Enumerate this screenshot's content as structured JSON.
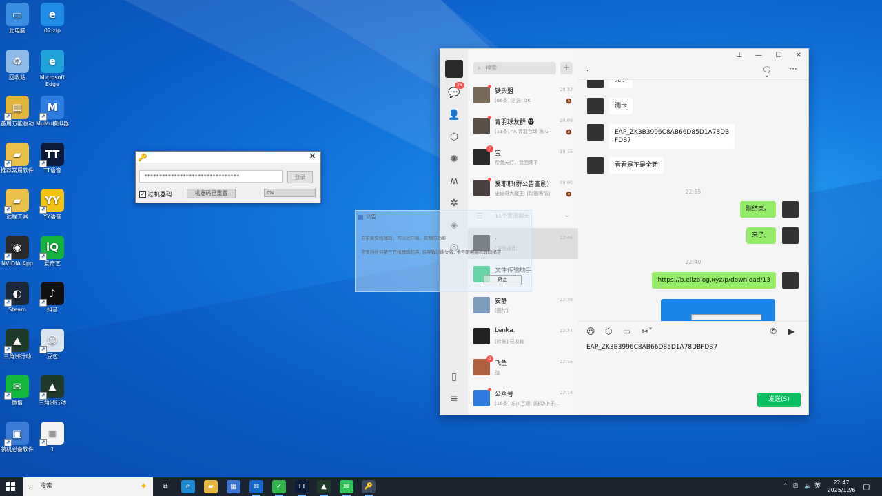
{
  "desktop": {
    "icons": [
      {
        "label": "此电脑",
        "icon": "computer-icon",
        "color": "#3a8fe0"
      },
      {
        "label": "02.zip",
        "icon": "ie-icon",
        "color": "#1f8ce6"
      },
      {
        "label": "回收站",
        "icon": "recycle-bin-icon",
        "color": "#8fb9e6"
      },
      {
        "label": "Microsoft Edge",
        "icon": "edge-icon",
        "color": "#1fa3d8"
      },
      {
        "label": "备用万能驱动",
        "icon": "driver-icon",
        "color": "#e2b43a"
      },
      {
        "label": "MuMu模拟器",
        "icon": "mumu-icon",
        "color": "#2f7de0"
      },
      {
        "label": "推荐常用软件",
        "icon": "folder-icon",
        "color": "#e8c04a"
      },
      {
        "label": "TT语音",
        "icon": "tt-icon",
        "color": "#0b1b3a"
      },
      {
        "label": "远程工具",
        "icon": "folder-icon",
        "color": "#e8c04a"
      },
      {
        "label": "YY语音",
        "icon": "yy-icon",
        "color": "#f2c311"
      },
      {
        "label": "NVIDIA App",
        "icon": "nvidia-icon",
        "color": "#2a2a2a"
      },
      {
        "label": "爱奇艺",
        "icon": "iqiyi-icon",
        "color": "#14b33c"
      },
      {
        "label": "Steam",
        "icon": "steam-icon",
        "color": "#1b2838"
      },
      {
        "label": "抖音",
        "icon": "douyin-icon",
        "color": "#111111"
      },
      {
        "label": "三角洲行动",
        "icon": "delta-icon",
        "color": "#1f3a2a"
      },
      {
        "label": "豆包",
        "icon": "doubao-icon",
        "color": "#d8e4f0"
      },
      {
        "label": "微信",
        "icon": "wechat-icon",
        "color": "#12b83c"
      },
      {
        "label": "三角洲行动",
        "icon": "delta-icon",
        "color": "#1f3a2a"
      },
      {
        "label": "装机必备软件",
        "icon": "installer-icon",
        "color": "#3a7bd5"
      },
      {
        "label": "1",
        "icon": "text-file-icon",
        "color": "#f4f4f4"
      }
    ]
  },
  "key_dialog": {
    "masked_value": "********************************",
    "login_label": "登录",
    "checkbox_label": "过机器码",
    "checkbox_mark": "✓",
    "reset_label": "机器码已重置",
    "lang_value": "CN"
  },
  "notice": {
    "title": "公告",
    "lines": [
      "自带真实机器码，可以过环境。有预防功能",
      "不支持任何第三方机器码程序, 会导致功能失效, 卡号跟电脑机器码绑定"
    ],
    "ok_label": "确定"
  },
  "wechat": {
    "unread_badge": "36",
    "search_placeholder": "搜索",
    "plus_label": "+",
    "chats": [
      {
        "name": "铁头盟",
        "preview": "[66条] 浩浩: OK",
        "time": "20:32",
        "muted": true,
        "dot": true,
        "count": "",
        "avatar_color": "#7a6a5a"
      },
      {
        "name": "青羽球友群 ⓬",
        "preview": "[11条] \"A.青羽台球 逸.G",
        "time": "20:09",
        "muted": true,
        "dot": true,
        "count": "",
        "avatar_color": "#5a5048"
      },
      {
        "name": "宝",
        "preview": "帮我关灯，我困死了",
        "time": "19:15",
        "muted": false,
        "dot": false,
        "count": "1",
        "avatar_color": "#2a2a2a"
      },
      {
        "name": "爱耶耶(群公告查剧)",
        "preview": "史迪奇大魔王: [动画表情]",
        "time": "09:00",
        "muted": true,
        "dot": true,
        "count": "",
        "avatar_color": "#4a4040"
      }
    ],
    "folded_label": "11个置顶聊天",
    "chats2": [
      {
        "name": ".",
        "preview": "[语音通话]",
        "time": "22:46",
        "muted": false,
        "dot": false,
        "count": "",
        "avatar_color": "#2a2a2a",
        "selected": true
      },
      {
        "name": "文件传输助手",
        "preview": "",
        "time": "",
        "muted": false,
        "dot": false,
        "count": "",
        "avatar_color": "#07c160"
      },
      {
        "name": "安静",
        "preview": "[图片]",
        "time": "22:39",
        "muted": false,
        "dot": false,
        "count": "",
        "avatar_color": "#7b9bbd"
      },
      {
        "name": "Lenka.",
        "preview": "[转账] 已收款",
        "time": "22:24",
        "muted": false,
        "dot": false,
        "count": "",
        "avatar_color": "#222222"
      },
      {
        "name": "飞鱼",
        "preview": "战",
        "time": "22:15",
        "muted": false,
        "dot": false,
        "count": "1",
        "avatar_color": "#b06040"
      },
      {
        "name": "公众号",
        "preview": "[16条] 忘川互娱: [联动小子...",
        "time": "22:14",
        "muted": false,
        "dot": true,
        "count": "",
        "avatar_color": "#2f7de0"
      }
    ],
    "chat_title": ".",
    "messages": [
      {
        "text": "完事",
        "side": "left"
      },
      {
        "text": "测卡",
        "side": "left"
      },
      {
        "text": "EAP_ZK3B3996C8AB66D85D1A78DB",
        "text2": "FDB7",
        "side": "left"
      },
      {
        "text": "看看是不是全新",
        "side": "left"
      },
      {
        "time": "22:35"
      },
      {
        "text": "刚结束。",
        "side": "right"
      },
      {
        "text": "来了。",
        "side": "right"
      },
      {
        "time": "22:40"
      },
      {
        "text": "https://b.ellzblog.xyz/p/download/13",
        "side": "right"
      }
    ],
    "draft": "EAP_ZK3B3996C8AB66D85D1A78DBFDB7",
    "send_label": "发送(S)"
  },
  "taskbar": {
    "search_placeholder": "搜索",
    "apps": [
      "task-view-icon",
      "edge-icon",
      "file-explorer-icon",
      "store-icon",
      "outlook-icon",
      "wechat-work-icon",
      "tt-icon",
      "delta-icon",
      "wechat-icon",
      "key-tool-icon"
    ],
    "ime": "英",
    "time": "22:47",
    "date": "2025/12/6"
  }
}
